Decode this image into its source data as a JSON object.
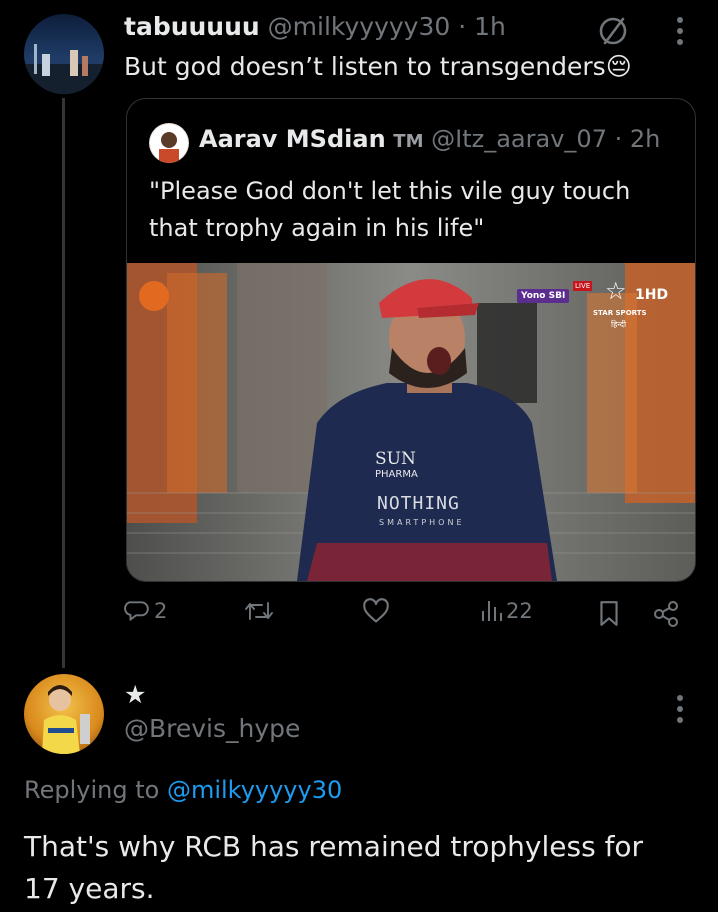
{
  "tweet": {
    "display_name": "tabuuuuu",
    "handle": "@milkyyyyy30",
    "time": "· 1h",
    "text": "But god doesn’t listen to transgenders",
    "emoji": "😔"
  },
  "quote": {
    "display_name": "Aarav MSdian",
    "badge": "TM",
    "handle": "@Itz_aarav_07",
    "time": "· 2h",
    "text_line1": "\"Please God don't let this vile guy touch",
    "text_line2": "that trophy again in his life\"",
    "image": {
      "sponsor_line1": "SUN",
      "sponsor_line2": "PHARMA",
      "shirt_text": "NOTHING",
      "shirt_sub": "SMARTPHONE",
      "broadcaster": "STAR SPORTS",
      "broadcaster_hindi": "हिन्दी",
      "channel": "1HD",
      "live": "LIVE",
      "yono": "Yono SBI"
    }
  },
  "actions": {
    "replies": "2",
    "views": "22"
  },
  "reply": {
    "display_name": "★",
    "handle": "@Brevis_hype",
    "replying_prefix": "Replying to ",
    "replying_to": "@milkyyyyy30",
    "text_line1": "That's why RCB has remained trophyless for",
    "text_line2": "17 years."
  },
  "colors": {
    "background": "#000000",
    "text": "#e7e9ea",
    "muted": "#71767b",
    "link": "#1d9bf0",
    "border": "#2f3336"
  }
}
